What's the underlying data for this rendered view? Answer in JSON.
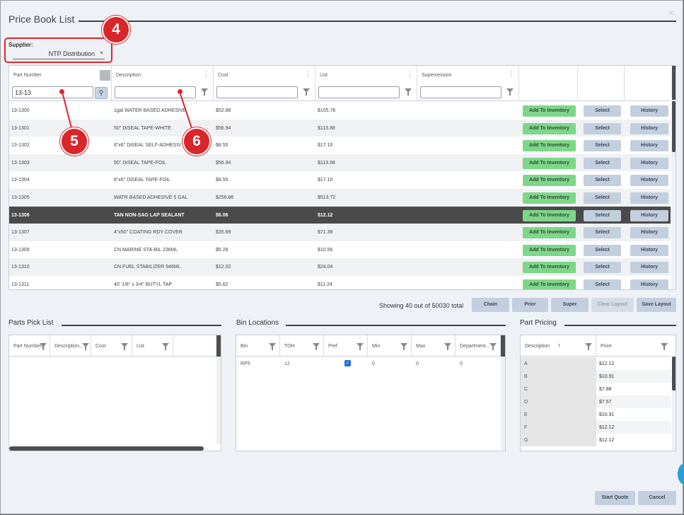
{
  "dialog": {
    "title": "Price Book List",
    "close_glyph": "×"
  },
  "supplier": {
    "label": "Supplier:",
    "value": "NTP Distribution"
  },
  "callouts": [
    "4",
    "5",
    "6"
  ],
  "grid": {
    "columns": {
      "part_number": "Part Number",
      "description": "Description",
      "cost": "Cost",
      "list": "List",
      "supercession": "Supercession"
    },
    "filters": {
      "part_number": "13-13",
      "description": "",
      "cost": "",
      "list": "",
      "supercession": ""
    },
    "rows": [
      {
        "part": "13-1300",
        "description": "1gal WATER BASED ADHESIVE",
        "cost": "$52.88",
        "list": "$105.76"
      },
      {
        "part": "13-1301",
        "description": "50\" DiSEAL TAPE-WHITE",
        "cost": "$56.94",
        "list": "$113.88"
      },
      {
        "part": "13-1302",
        "description": "6\"x6\" DiSEAL SELF-ADHESIV",
        "cost": "$8.55",
        "list": "$17.10"
      },
      {
        "part": "13-1303",
        "description": "50\" DiSEAL TAPE-FOIL",
        "cost": "$56.94",
        "list": "$113.88"
      },
      {
        "part": "13-1304",
        "description": "6\"x6\" DiSEAL TAPE-FOIL",
        "cost": "$8.55",
        "list": "$17.10"
      },
      {
        "part": "13-1305",
        "description": "WATR BASED ADHESIVE 5 GAL",
        "cost": "$256.86",
        "list": "$513.72"
      },
      {
        "part": "13-1306",
        "description": "TAN NON-SAG LAP SEALANT",
        "cost": "$6.06",
        "list": "$12.12"
      },
      {
        "part": "13-1307",
        "description": "4\"x50\" COATING RDY COVER",
        "cost": "$35.69",
        "list": "$71.38"
      },
      {
        "part": "13-1309",
        "description": "CN MARINE STA-BIL 236ML",
        "cost": "$5.28",
        "list": "$10.56"
      },
      {
        "part": "13-1310",
        "description": "CN FUEL STABILIZER 946ML",
        "cost": "$12.02",
        "list": "$24.04"
      },
      {
        "part": "13-1311",
        "description": "40' 1/8\" x 3/4\" BUTYL TAP",
        "cost": "$5.62",
        "list": "$11.24"
      }
    ],
    "selected_row_index": 6,
    "row_buttons": {
      "add": "Add To Inventory",
      "select": "Select",
      "history": "History"
    }
  },
  "footer": {
    "count_text": "Showing 40 out of 50030 total",
    "buttons": {
      "chain": "Chain",
      "prior": "Prior",
      "super": "Super",
      "clear_layout": "Clear Layout",
      "save_layout": "Save Layout"
    }
  },
  "parts_pick_list": {
    "title": "Parts Pick List",
    "columns": [
      "Part Number...",
      "Description...",
      "Cost",
      "List"
    ]
  },
  "bin_locations": {
    "title": "Bin Locations",
    "columns": [
      "Bin",
      "TOH",
      "Pref",
      "Min",
      "Max",
      "Department..."
    ],
    "rows": [
      {
        "bin": "RP5",
        "toh": "12",
        "pref": true,
        "min": "0",
        "max": "0",
        "department": "0"
      }
    ]
  },
  "part_pricing": {
    "title": "Part Pricing",
    "columns": [
      "Description",
      "Price"
    ],
    "sort_glyph": "↑",
    "rows": [
      {
        "desc": "A",
        "price": "$12.12"
      },
      {
        "desc": "B",
        "price": "$10.91"
      },
      {
        "desc": "C",
        "price": "$7.88"
      },
      {
        "desc": "D",
        "price": "$7.57"
      },
      {
        "desc": "E",
        "price": "$10.91"
      },
      {
        "desc": "F",
        "price": "$12.12"
      },
      {
        "desc": "G",
        "price": "$12.12"
      }
    ]
  },
  "actions": {
    "start_quote": "Start Quote",
    "cancel": "Cancel"
  },
  "colors": {
    "accent_green": "#7ed68a",
    "button_blue": "#c3cfdf",
    "selected_row": "#4a4a4a",
    "callout_red": "#d9262b"
  }
}
